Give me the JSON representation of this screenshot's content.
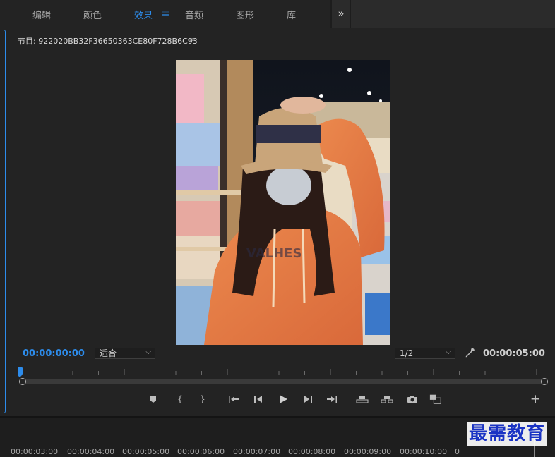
{
  "workspace_tabs": [
    {
      "label": "编辑",
      "active": false
    },
    {
      "label": "颜色",
      "active": false
    },
    {
      "label": "效果",
      "active": true
    },
    {
      "label": "音频",
      "active": false
    },
    {
      "label": "图形",
      "active": false
    },
    {
      "label": "库",
      "active": false
    }
  ],
  "workspace_more_icon": "double-chevron-right-icon",
  "panel": {
    "title": "节目: 922020BB32F36650363CE80F728B6C93",
    "menu_icon": "hamburger-menu-icon"
  },
  "monitor": {
    "current_timecode": "00:00:00:00",
    "fit_label": "适合",
    "resolution_label": "1/2",
    "duration_timecode": "00:00:05:00",
    "settings_icon": "wrench-icon",
    "playhead_position": 0
  },
  "controls": [
    {
      "name": "add-marker-button",
      "icon": "marker-icon"
    },
    {
      "name": "mark-in-button",
      "icon": "mark-in-icon"
    },
    {
      "name": "mark-out-button",
      "icon": "mark-out-icon"
    },
    {
      "name": "go-to-in-button",
      "icon": "go-to-in-icon"
    },
    {
      "name": "step-back-button",
      "icon": "step-back-icon"
    },
    {
      "name": "play-button",
      "icon": "play-icon"
    },
    {
      "name": "step-forward-button",
      "icon": "step-forward-icon"
    },
    {
      "name": "go-to-out-button",
      "icon": "go-to-out-icon"
    },
    {
      "name": "lift-button",
      "icon": "lift-icon"
    },
    {
      "name": "extract-button",
      "icon": "extract-icon"
    },
    {
      "name": "export-frame-button",
      "icon": "camera-icon"
    },
    {
      "name": "comparison-view-button",
      "icon": "comparison-icon"
    },
    {
      "name": "button-editor-button",
      "icon": "plus-icon"
    }
  ],
  "timeline": {
    "labels": [
      "00:00:03:00",
      "00:00:04:00",
      "00:00:05:00",
      "00:00:06:00",
      "00:00:07:00",
      "00:00:08:00",
      "00:00:09:00",
      "00:00:10:00",
      "0"
    ]
  },
  "watermark_text": "最需教育",
  "colors": {
    "accent": "#2d8ceb",
    "panel_bg": "#232323",
    "text": "#cfcfcf",
    "watermark": "#1a33c4"
  }
}
